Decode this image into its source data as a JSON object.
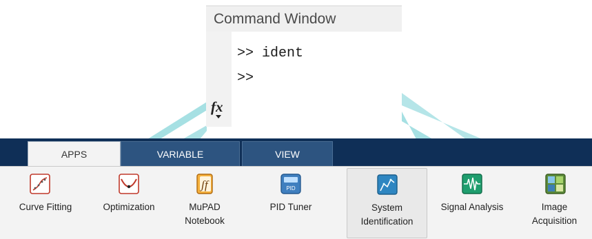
{
  "command_window": {
    "title": "Command Window",
    "lines": [
      ">> ident",
      ">>"
    ],
    "function_icon": "fx"
  },
  "ribbon": {
    "tabs": [
      {
        "label": "APPS",
        "active": true
      },
      {
        "label": "VARIABLE",
        "active": false
      },
      {
        "label": "VIEW",
        "active": false
      }
    ],
    "apps": [
      {
        "label": "Curve Fitting",
        "icon": "curve-fitting-icon"
      },
      {
        "label": "Optimization",
        "icon": "optimization-icon"
      },
      {
        "label": "MuPAD\nNotebook",
        "icon": "mupad-icon"
      },
      {
        "label": "PID Tuner",
        "icon": "pid-icon"
      },
      {
        "label": "System\nIdentification",
        "icon": "system-identification-icon",
        "selected": true
      },
      {
        "label": "Signal Analysis",
        "icon": "signal-analysis-icon"
      },
      {
        "label": "Image\nAcquisition",
        "icon": "image-acquisition-icon"
      }
    ]
  },
  "colors": {
    "tabstrip": "#0f2f57",
    "accent_teal": "#4bbfc8"
  }
}
